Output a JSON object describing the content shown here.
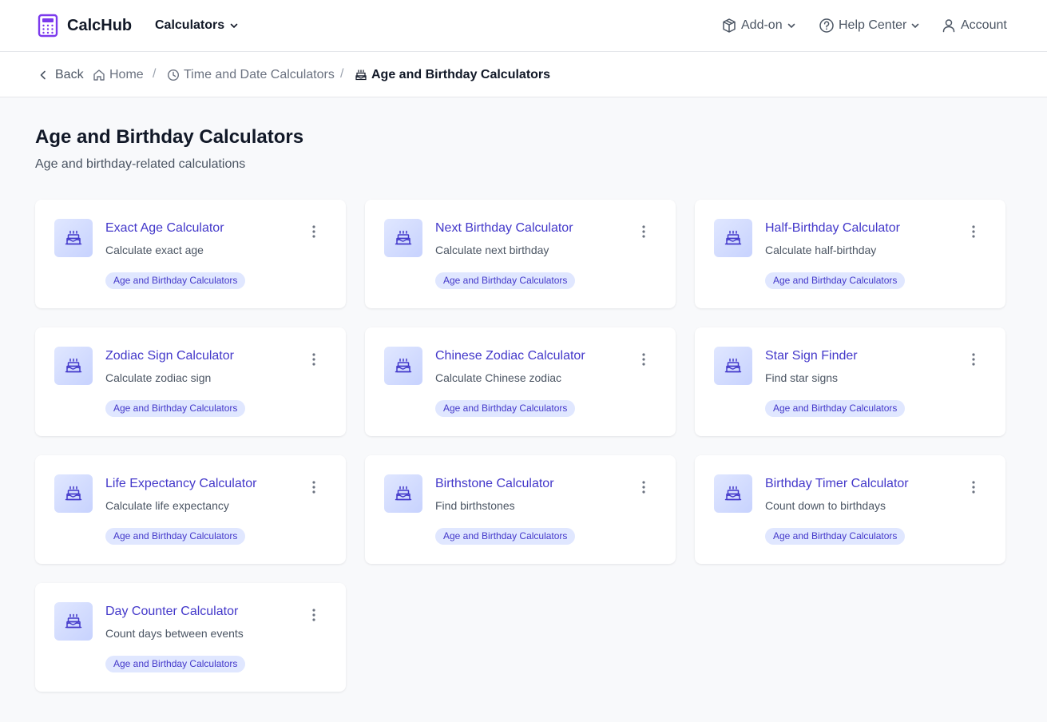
{
  "header": {
    "app_name": "CalcHub",
    "calculators_menu": "Calculators",
    "addon_menu": "Add-on",
    "help_menu": "Help Center",
    "account_link": "Account"
  },
  "breadcrumb": {
    "back": "Back",
    "home": "Home",
    "separator": "/",
    "parent": "Time and Date Calculators",
    "current": "Age and Birthday Calculators"
  },
  "page": {
    "title": "Age and Birthday Calculators",
    "subtitle": "Age and birthday-related calculations"
  },
  "cards": [
    {
      "title": "Exact Age Calculator",
      "description": "Calculate exact age",
      "tag": "Age and Birthday Calculators"
    },
    {
      "title": "Next Birthday Calculator",
      "description": "Calculate next birthday",
      "tag": "Age and Birthday Calculators"
    },
    {
      "title": "Half-Birthday Calculator",
      "description": "Calculate half-birthday",
      "tag": "Age and Birthday Calculators"
    },
    {
      "title": "Zodiac Sign Calculator",
      "description": "Calculate zodiac sign",
      "tag": "Age and Birthday Calculators"
    },
    {
      "title": "Chinese Zodiac Calculator",
      "description": "Calculate Chinese zodiac",
      "tag": "Age and Birthday Calculators"
    },
    {
      "title": "Star Sign Finder",
      "description": "Find star signs",
      "tag": "Age and Birthday Calculators"
    },
    {
      "title": "Life Expectancy Calculator",
      "description": "Calculate life expectancy",
      "tag": "Age and Birthday Calculators"
    },
    {
      "title": "Birthstone Calculator",
      "description": "Find birthstones",
      "tag": "Age and Birthday Calculators"
    },
    {
      "title": "Birthday Timer Calculator",
      "description": "Count down to birthdays",
      "tag": "Age and Birthday Calculators"
    },
    {
      "title": "Day Counter Calculator",
      "description": "Count days between events",
      "tag": "Age and Birthday Calculators"
    }
  ],
  "icons": {
    "logo": "calculator-icon",
    "card": "birthday-cake-icon",
    "addon": "package-icon",
    "help": "help-circle-icon",
    "account": "user-icon",
    "home": "home-icon",
    "parent": "clock-icon",
    "current": "birthday-cake-icon",
    "card_menu": "more-vertical-icon"
  },
  "colors": {
    "accent": "#4338ca",
    "logo": "#7c3aed",
    "tag_bg": "#e0e7ff",
    "page_bg": "#f8f9fb"
  }
}
